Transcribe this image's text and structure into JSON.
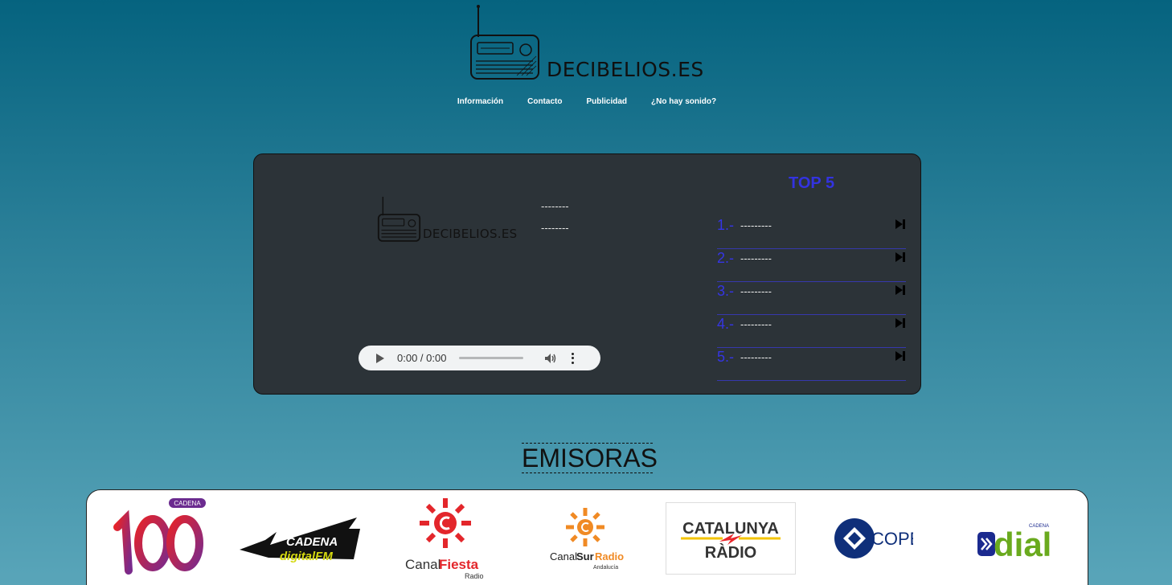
{
  "header": {
    "logo_text": "DECIBELIOS.ES",
    "nav": [
      "Información",
      "Contacto",
      "Publicidad",
      "¿No hay sonido?"
    ]
  },
  "player": {
    "logo_text": "DECIBELIOS.ES",
    "now_line_1": "--------",
    "now_line_2": "--------",
    "audio_time": "0:00 / 0:00",
    "top5_title": "TOP 5",
    "top5": [
      {
        "num": "1.-",
        "text": "---------"
      },
      {
        "num": "2.-",
        "text": "---------"
      },
      {
        "num": "3.-",
        "text": "---------"
      },
      {
        "num": "4.-",
        "text": "---------"
      },
      {
        "num": "5.-",
        "text": "---------"
      }
    ]
  },
  "stations_title": "EMISORAS",
  "stations": {
    "cadena100": {
      "badge": "CADENA",
      "number": "100"
    },
    "cadena_digital": {
      "top": "CADENA",
      "bottom": "digitalFM"
    },
    "canal_fiesta": {
      "word1": "Canal",
      "word2": "Fiesta",
      "sub": "Radio"
    },
    "canal_sur": {
      "word1": "Canal",
      "word2": "Sur",
      "word3": "Radio",
      "sub": "Andalucía"
    },
    "catalunya": {
      "line1": "CATALUNYA",
      "line2": "RÀDIO"
    },
    "cope": {
      "text": "COPE"
    },
    "dial": {
      "top": "CADENA",
      "text": "dial"
    }
  },
  "colors": {
    "bg_top": "#05637f",
    "bg_bottom": "#59a5b9",
    "player_bg": "#2c3338",
    "top5_accent": "#3535e5"
  }
}
